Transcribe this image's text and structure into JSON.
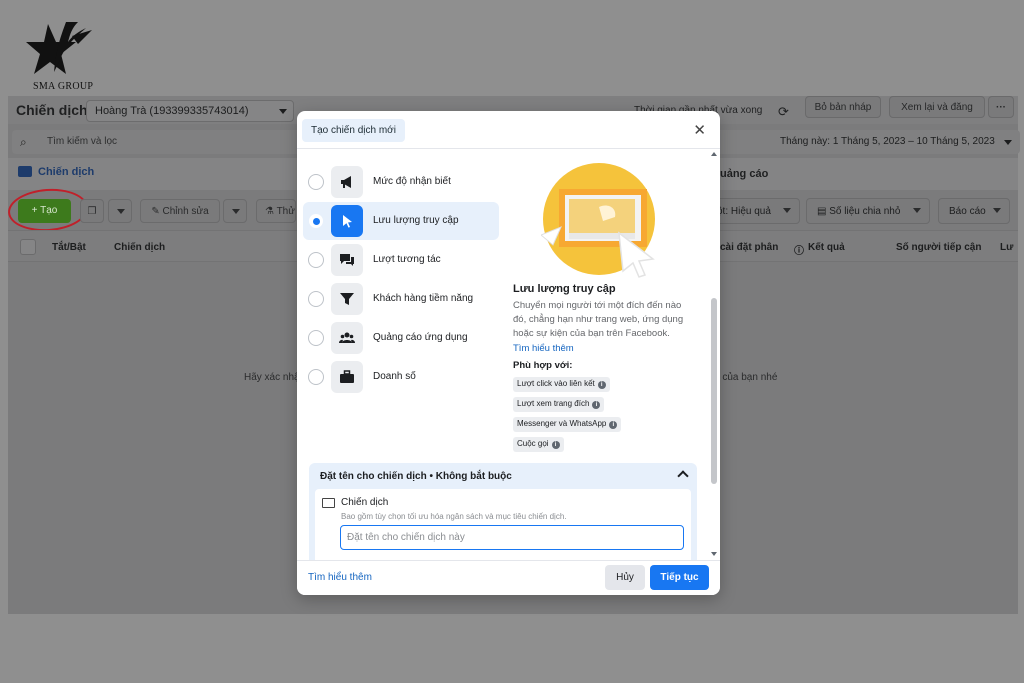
{
  "logo": {
    "text": "SMA GROUP"
  },
  "header": {
    "title": "Chiến dịch",
    "account": "Hoàng Trà (193399335743014)",
    "updated": "Thời gian gần nhất vừa xong",
    "discard_label": "Bỏ bản nháp",
    "review_label": "Xem lại và đăng"
  },
  "search": {
    "placeholder": "Tìm kiếm và lọc"
  },
  "date_range": "Tháng này: 1 Tháng 5, 2023 – 10 Tháng 5, 2023",
  "tabs": {
    "campaigns": "Chiến dịch",
    "ads": "uảng cáo"
  },
  "toolbar": {
    "create_label": "+ Tạo",
    "edit_label": "Chỉnh sửa",
    "test_label": "Thử",
    "performance_label": "ột: Hiệu quả",
    "breakdown_label": "Số liệu chia nhỏ",
    "reports_label": "Báo cáo"
  },
  "columns": {
    "toggle": "Tắt/Bật",
    "campaign": "Chiến dịch",
    "budget": "cài đặt phân",
    "results": "Kết quả",
    "reach": "Số người tiếp cận",
    "more": "Lư"
  },
  "empty": {
    "left": "Hãy xác nhậ",
    "right": "n của bạn nhé"
  },
  "modal": {
    "title": "Tạo chiến dịch mới",
    "objectives": [
      {
        "label": "Mức độ nhận biết",
        "icon": "megaphone-icon"
      },
      {
        "label": "Lưu lượng truy cập",
        "icon": "cursor-icon",
        "selected": true
      },
      {
        "label": "Lượt tương tác",
        "icon": "chat-icon"
      },
      {
        "label": "Khách hàng tiềm năng",
        "icon": "funnel-icon"
      },
      {
        "label": "Quảng cáo ứng dụng",
        "icon": "people-icon"
      },
      {
        "label": "Doanh số",
        "icon": "briefcase-icon"
      }
    ],
    "detail": {
      "title": "Lưu lượng truy cập",
      "description": "Chuyển mọi người tới một đích đến nào đó, chẳng hạn như trang web, ứng dụng hoặc sự kiện của bạn trên Facebook.",
      "learn_more": "Tìm hiểu thêm",
      "fit_title": "Phù hợp với:",
      "fits": [
        "Lượt click vào liên kết",
        "Lượt xem trang đích",
        "Messenger và WhatsApp",
        "Cuộc gọi"
      ]
    },
    "name_section": {
      "header": "Đặt tên cho chiến dịch • Không bắt buộc",
      "card_title": "Chiến dịch",
      "card_subtitle": "Bao gồm tùy chọn tối ưu hóa ngân sách và mục tiêu chiến dịch.",
      "input_placeholder": "Đặt tên cho chiến dịch này",
      "input_value": ""
    },
    "footer": {
      "learn_more": "Tìm hiểu thêm",
      "cancel": "Hủy",
      "continue": "Tiếp tục"
    }
  },
  "colors": {
    "primary": "#1877f2",
    "create_green": "#42b72a",
    "annotation_red": "#c0202a"
  }
}
